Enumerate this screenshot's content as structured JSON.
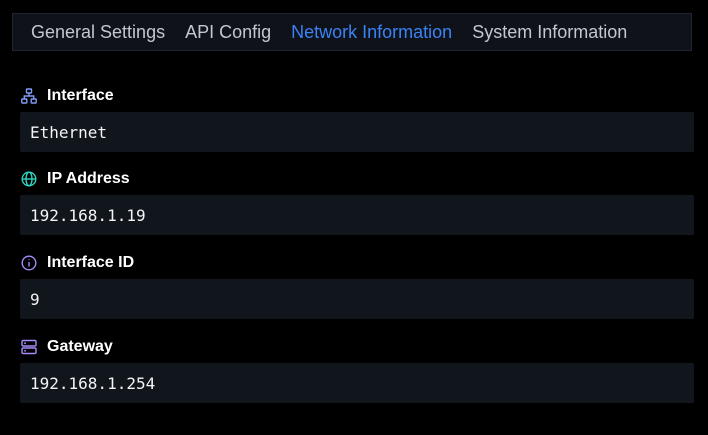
{
  "tabs": [
    {
      "label": "General Settings",
      "active": false
    },
    {
      "label": "API Config",
      "active": false
    },
    {
      "label": "Network Information",
      "active": true
    },
    {
      "label": "System Information",
      "active": false
    }
  ],
  "fields": [
    {
      "label": "Interface",
      "value": "Ethernet",
      "icon": "network-icon",
      "icon_color": "#7f9cf5"
    },
    {
      "label": "IP Address",
      "value": "192.168.1.19",
      "icon": "globe-icon",
      "icon_color": "#2dd4bf"
    },
    {
      "label": "Interface ID",
      "value": "9",
      "icon": "info-icon",
      "icon_color": "#a78bfa"
    },
    {
      "label": "Gateway",
      "value": "192.168.1.254",
      "icon": "server-icon",
      "icon_color": "#a78bfa"
    }
  ],
  "colors": {
    "background": "#000000",
    "tab_active": "#3b82f6",
    "tab_inactive": "#c2c7d0",
    "field_bg": "#11151c"
  }
}
